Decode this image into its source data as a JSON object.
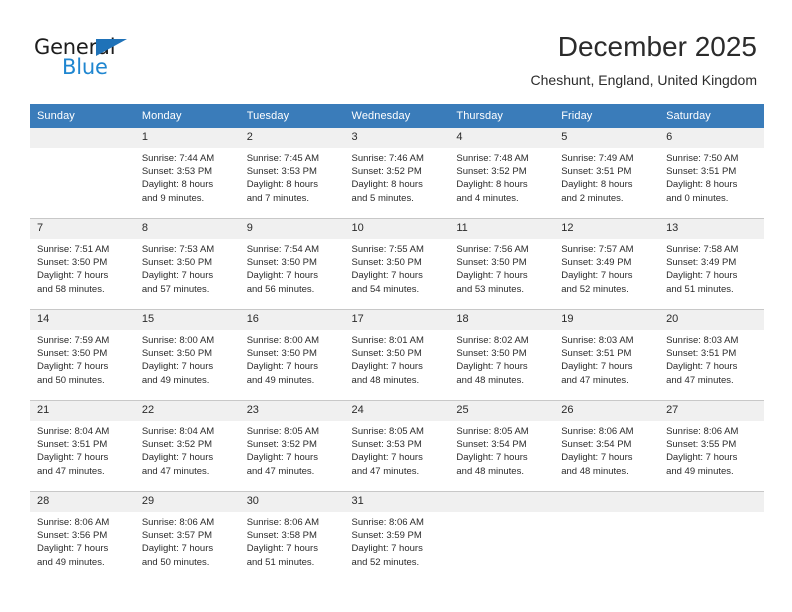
{
  "brand": {
    "name_part1": "General",
    "name_part2": "Blue",
    "accent_color": "#1f86d0",
    "triangle_color": "#1f72b8"
  },
  "header": {
    "title": "December 2025",
    "subtitle": "Cheshunt, England, United Kingdom"
  },
  "calendar": {
    "header_bg": "#3a7cba",
    "daynum_bg": "#f0f0f0",
    "weekday_headers": [
      "Sunday",
      "Monday",
      "Tuesday",
      "Wednesday",
      "Thursday",
      "Friday",
      "Saturday"
    ],
    "weeks": [
      [
        {
          "day": "",
          "sunrise": "",
          "sunset": "",
          "daylight_line1": "",
          "daylight_line2": "",
          "blank": true
        },
        {
          "day": "1",
          "sunrise": "Sunrise: 7:44 AM",
          "sunset": "Sunset: 3:53 PM",
          "daylight_line1": "Daylight: 8 hours",
          "daylight_line2": "and 9 minutes."
        },
        {
          "day": "2",
          "sunrise": "Sunrise: 7:45 AM",
          "sunset": "Sunset: 3:53 PM",
          "daylight_line1": "Daylight: 8 hours",
          "daylight_line2": "and 7 minutes."
        },
        {
          "day": "3",
          "sunrise": "Sunrise: 7:46 AM",
          "sunset": "Sunset: 3:52 PM",
          "daylight_line1": "Daylight: 8 hours",
          "daylight_line2": "and 5 minutes."
        },
        {
          "day": "4",
          "sunrise": "Sunrise: 7:48 AM",
          "sunset": "Sunset: 3:52 PM",
          "daylight_line1": "Daylight: 8 hours",
          "daylight_line2": "and 4 minutes."
        },
        {
          "day": "5",
          "sunrise": "Sunrise: 7:49 AM",
          "sunset": "Sunset: 3:51 PM",
          "daylight_line1": "Daylight: 8 hours",
          "daylight_line2": "and 2 minutes."
        },
        {
          "day": "6",
          "sunrise": "Sunrise: 7:50 AM",
          "sunset": "Sunset: 3:51 PM",
          "daylight_line1": "Daylight: 8 hours",
          "daylight_line2": "and 0 minutes."
        }
      ],
      [
        {
          "day": "7",
          "sunrise": "Sunrise: 7:51 AM",
          "sunset": "Sunset: 3:50 PM",
          "daylight_line1": "Daylight: 7 hours",
          "daylight_line2": "and 58 minutes."
        },
        {
          "day": "8",
          "sunrise": "Sunrise: 7:53 AM",
          "sunset": "Sunset: 3:50 PM",
          "daylight_line1": "Daylight: 7 hours",
          "daylight_line2": "and 57 minutes."
        },
        {
          "day": "9",
          "sunrise": "Sunrise: 7:54 AM",
          "sunset": "Sunset: 3:50 PM",
          "daylight_line1": "Daylight: 7 hours",
          "daylight_line2": "and 56 minutes."
        },
        {
          "day": "10",
          "sunrise": "Sunrise: 7:55 AM",
          "sunset": "Sunset: 3:50 PM",
          "daylight_line1": "Daylight: 7 hours",
          "daylight_line2": "and 54 minutes."
        },
        {
          "day": "11",
          "sunrise": "Sunrise: 7:56 AM",
          "sunset": "Sunset: 3:50 PM",
          "daylight_line1": "Daylight: 7 hours",
          "daylight_line2": "and 53 minutes."
        },
        {
          "day": "12",
          "sunrise": "Sunrise: 7:57 AM",
          "sunset": "Sunset: 3:49 PM",
          "daylight_line1": "Daylight: 7 hours",
          "daylight_line2": "and 52 minutes."
        },
        {
          "day": "13",
          "sunrise": "Sunrise: 7:58 AM",
          "sunset": "Sunset: 3:49 PM",
          "daylight_line1": "Daylight: 7 hours",
          "daylight_line2": "and 51 minutes."
        }
      ],
      [
        {
          "day": "14",
          "sunrise": "Sunrise: 7:59 AM",
          "sunset": "Sunset: 3:50 PM",
          "daylight_line1": "Daylight: 7 hours",
          "daylight_line2": "and 50 minutes."
        },
        {
          "day": "15",
          "sunrise": "Sunrise: 8:00 AM",
          "sunset": "Sunset: 3:50 PM",
          "daylight_line1": "Daylight: 7 hours",
          "daylight_line2": "and 49 minutes."
        },
        {
          "day": "16",
          "sunrise": "Sunrise: 8:00 AM",
          "sunset": "Sunset: 3:50 PM",
          "daylight_line1": "Daylight: 7 hours",
          "daylight_line2": "and 49 minutes."
        },
        {
          "day": "17",
          "sunrise": "Sunrise: 8:01 AM",
          "sunset": "Sunset: 3:50 PM",
          "daylight_line1": "Daylight: 7 hours",
          "daylight_line2": "and 48 minutes."
        },
        {
          "day": "18",
          "sunrise": "Sunrise: 8:02 AM",
          "sunset": "Sunset: 3:50 PM",
          "daylight_line1": "Daylight: 7 hours",
          "daylight_line2": "and 48 minutes."
        },
        {
          "day": "19",
          "sunrise": "Sunrise: 8:03 AM",
          "sunset": "Sunset: 3:51 PM",
          "daylight_line1": "Daylight: 7 hours",
          "daylight_line2": "and 47 minutes."
        },
        {
          "day": "20",
          "sunrise": "Sunrise: 8:03 AM",
          "sunset": "Sunset: 3:51 PM",
          "daylight_line1": "Daylight: 7 hours",
          "daylight_line2": "and 47 minutes."
        }
      ],
      [
        {
          "day": "21",
          "sunrise": "Sunrise: 8:04 AM",
          "sunset": "Sunset: 3:51 PM",
          "daylight_line1": "Daylight: 7 hours",
          "daylight_line2": "and 47 minutes."
        },
        {
          "day": "22",
          "sunrise": "Sunrise: 8:04 AM",
          "sunset": "Sunset: 3:52 PM",
          "daylight_line1": "Daylight: 7 hours",
          "daylight_line2": "and 47 minutes."
        },
        {
          "day": "23",
          "sunrise": "Sunrise: 8:05 AM",
          "sunset": "Sunset: 3:52 PM",
          "daylight_line1": "Daylight: 7 hours",
          "daylight_line2": "and 47 minutes."
        },
        {
          "day": "24",
          "sunrise": "Sunrise: 8:05 AM",
          "sunset": "Sunset: 3:53 PM",
          "daylight_line1": "Daylight: 7 hours",
          "daylight_line2": "and 47 minutes."
        },
        {
          "day": "25",
          "sunrise": "Sunrise: 8:05 AM",
          "sunset": "Sunset: 3:54 PM",
          "daylight_line1": "Daylight: 7 hours",
          "daylight_line2": "and 48 minutes."
        },
        {
          "day": "26",
          "sunrise": "Sunrise: 8:06 AM",
          "sunset": "Sunset: 3:54 PM",
          "daylight_line1": "Daylight: 7 hours",
          "daylight_line2": "and 48 minutes."
        },
        {
          "day": "27",
          "sunrise": "Sunrise: 8:06 AM",
          "sunset": "Sunset: 3:55 PM",
          "daylight_line1": "Daylight: 7 hours",
          "daylight_line2": "and 49 minutes."
        }
      ],
      [
        {
          "day": "28",
          "sunrise": "Sunrise: 8:06 AM",
          "sunset": "Sunset: 3:56 PM",
          "daylight_line1": "Daylight: 7 hours",
          "daylight_line2": "and 49 minutes."
        },
        {
          "day": "29",
          "sunrise": "Sunrise: 8:06 AM",
          "sunset": "Sunset: 3:57 PM",
          "daylight_line1": "Daylight: 7 hours",
          "daylight_line2": "and 50 minutes."
        },
        {
          "day": "30",
          "sunrise": "Sunrise: 8:06 AM",
          "sunset": "Sunset: 3:58 PM",
          "daylight_line1": "Daylight: 7 hours",
          "daylight_line2": "and 51 minutes."
        },
        {
          "day": "31",
          "sunrise": "Sunrise: 8:06 AM",
          "sunset": "Sunset: 3:59 PM",
          "daylight_line1": "Daylight: 7 hours",
          "daylight_line2": "and 52 minutes."
        },
        {
          "day": "",
          "sunrise": "",
          "sunset": "",
          "daylight_line1": "",
          "daylight_line2": "",
          "blank": true
        },
        {
          "day": "",
          "sunrise": "",
          "sunset": "",
          "daylight_line1": "",
          "daylight_line2": "",
          "blank": true
        },
        {
          "day": "",
          "sunrise": "",
          "sunset": "",
          "daylight_line1": "",
          "daylight_line2": "",
          "blank": true
        }
      ]
    ]
  }
}
